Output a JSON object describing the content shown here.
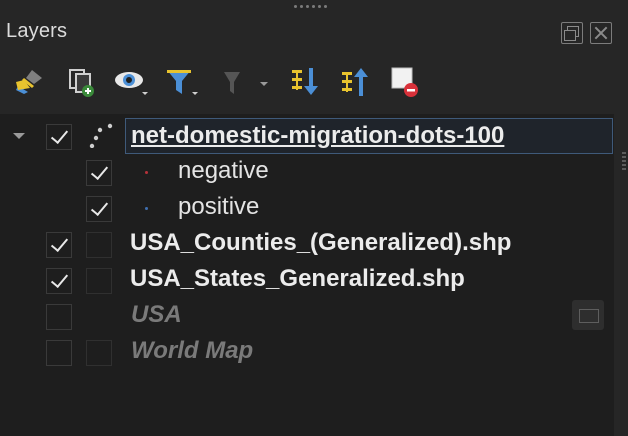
{
  "panel": {
    "title": "Layers",
    "float_button": "float-icon",
    "close_button": "close-icon"
  },
  "toolbar": [
    {
      "name": "style-manager-button",
      "icon": "paint-brush-icon"
    },
    {
      "name": "add-group-button",
      "icon": "add-group-icon"
    },
    {
      "name": "manage-map-themes-button",
      "icon": "eye-icon"
    },
    {
      "name": "filter-legend-button",
      "icon": "funnel-icon"
    },
    {
      "name": "filter-by-expression-button",
      "icon": "expression-filter-icon"
    },
    {
      "name": "expand-all-button",
      "icon": "expand-all-icon"
    },
    {
      "name": "collapse-all-button",
      "icon": "collapse-all-icon"
    },
    {
      "name": "remove-layer-button",
      "icon": "remove-layer-icon"
    }
  ],
  "layers": [
    {
      "label": "net-domestic-migration-dots-100",
      "checked": true,
      "style": "bold",
      "selected": true,
      "expanded": true
    },
    {
      "label": "negative",
      "checked": true,
      "style": "normal",
      "child": true,
      "symbol_color": "#b5323a"
    },
    {
      "label": "positive",
      "checked": true,
      "style": "normal",
      "child": true,
      "symbol_color": "#3f6fb0"
    },
    {
      "label": "USA_Counties_(Generalized).shp",
      "checked": true,
      "style": "bold"
    },
    {
      "label": "USA_States_Generalized.shp",
      "checked": true,
      "style": "bold"
    },
    {
      "label": "USA",
      "checked": false,
      "style": "italic"
    },
    {
      "label": "World Map",
      "checked": false,
      "style": "italic"
    }
  ],
  "colors": {
    "background": "#262626",
    "tree_background": "#1e1e1e",
    "accent_yellow": "#e8c32e",
    "accent_blue": "#4b8fd6",
    "remove_red": "#d8313a"
  }
}
